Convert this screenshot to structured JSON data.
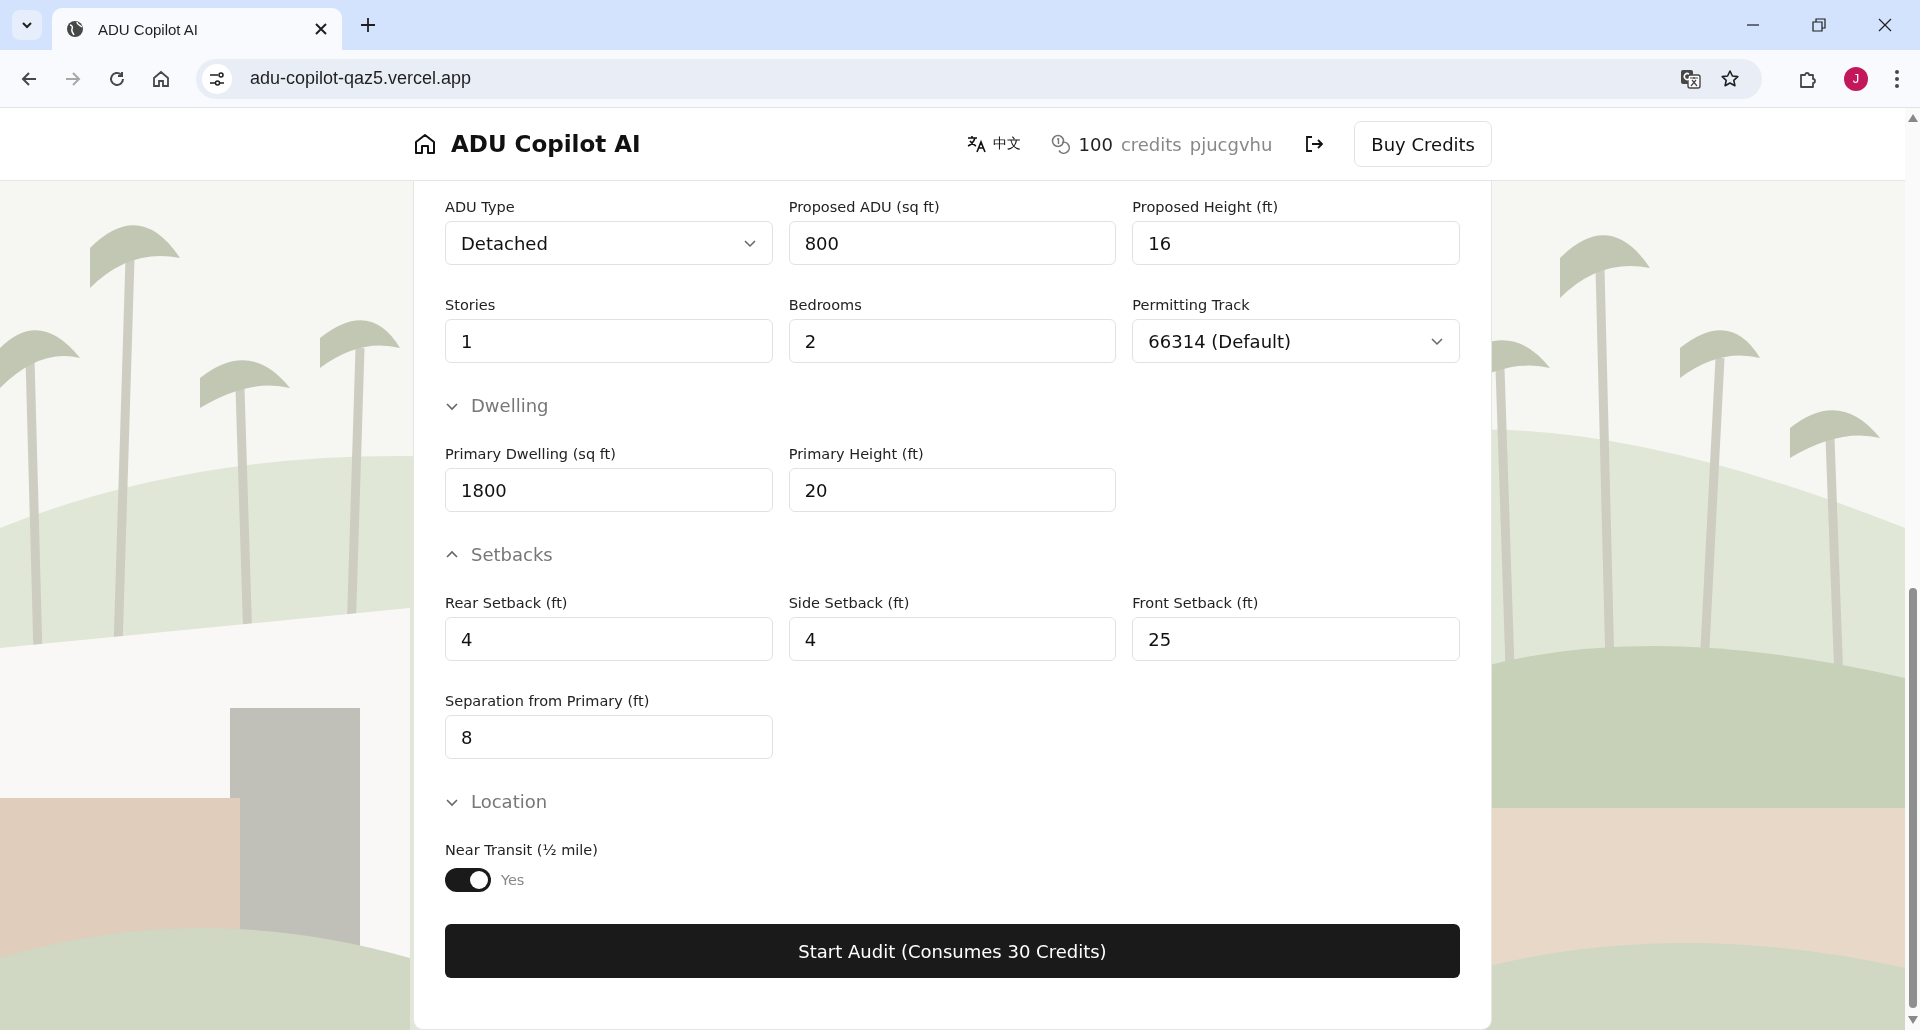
{
  "browser": {
    "tab_title": "ADU Copilot AI",
    "url": "adu-copilot-qaz5.vercel.app",
    "profile_initial": "J"
  },
  "header": {
    "title": "ADU Copilot AI",
    "language": "中文",
    "credits_count": "100",
    "credits_label": "credits",
    "username": "pjucgvhu",
    "buy_button": "Buy Credits"
  },
  "sections": [
    {
      "fields": [
        {
          "kind": "select",
          "label": "ADU Type",
          "value": "Detached"
        },
        {
          "kind": "input",
          "label": "Proposed ADU (sq ft)",
          "value": "800"
        },
        {
          "kind": "input",
          "label": "Proposed Height (ft)",
          "value": "16"
        },
        {
          "kind": "input",
          "label": "Stories",
          "value": "1"
        },
        {
          "kind": "input",
          "label": "Bedrooms",
          "value": "2"
        },
        {
          "kind": "select",
          "label": "Permitting Track",
          "value": "66314 (Default)"
        }
      ]
    },
    {
      "title": "Dwelling",
      "expanded": false,
      "fields": [
        {
          "kind": "input",
          "label": "Primary Dwelling (sq ft)",
          "value": "1800"
        },
        {
          "kind": "input",
          "label": "Primary Height (ft)",
          "value": "20"
        }
      ]
    },
    {
      "title": "Setbacks",
      "expanded": true,
      "fields": [
        {
          "kind": "input",
          "label": "Rear Setback (ft)",
          "value": "4"
        },
        {
          "kind": "input",
          "label": "Side Setback (ft)",
          "value": "4"
        },
        {
          "kind": "input",
          "label": "Front Setback (ft)",
          "value": "25"
        },
        {
          "kind": "input",
          "label": "Separation from Primary (ft)",
          "value": "8"
        }
      ]
    },
    {
      "title": "Location",
      "expanded": false,
      "fields": [
        {
          "kind": "toggle",
          "label": "Near Transit (½ mile)",
          "on": true,
          "value": "Yes"
        }
      ]
    }
  ],
  "submit_button": "Start Audit (Consumes 30 Credits)"
}
